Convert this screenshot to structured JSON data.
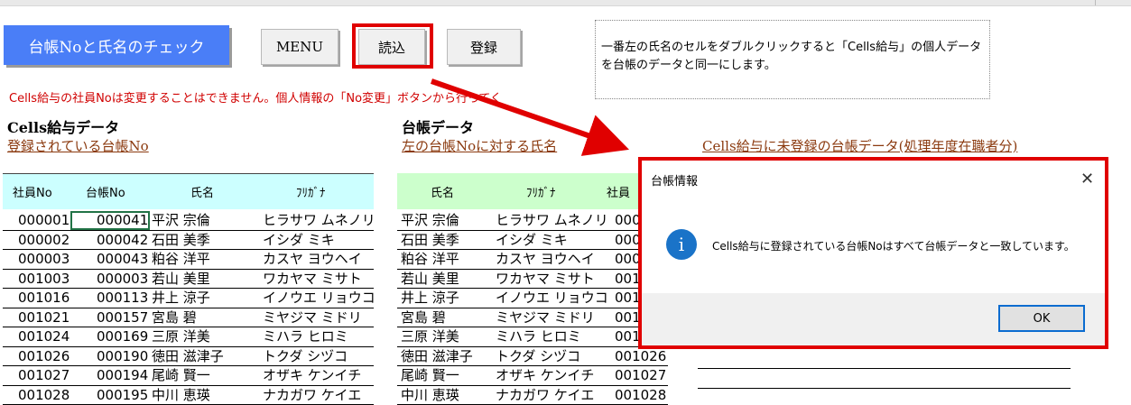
{
  "toolbar": {
    "title_button": "台帳Noと氏名のチェック",
    "menu_button": "MENU",
    "read_button": "読込",
    "register_button": "登録"
  },
  "note": "一番左の氏名のセルをダブルクリックすると「Cells給与」の個人データを台帳のデータと同一にします。",
  "warning": "Cells給与の社員Noは変更することはできません。個人情報の「No変更」ボタンから行ってく",
  "left_section": {
    "title": "Cells給与データ",
    "link": "登録されている台帳No",
    "headers": [
      "社員No",
      "台帳No",
      "氏名",
      "ﾌﾘｶﾞﾅ"
    ],
    "rows": [
      [
        "000001",
        "000041",
        "平沢 宗倫",
        "ヒラサワ ムネノリ"
      ],
      [
        "000002",
        "000042",
        "石田 美季",
        "イシダ ミキ"
      ],
      [
        "000003",
        "000043",
        "粕谷 洋平",
        "カスヤ ヨウヘイ"
      ],
      [
        "001003",
        "000003",
        "若山 美里",
        "ワカヤマ ミサト"
      ],
      [
        "001016",
        "000113",
        "井上 涼子",
        "イノウエ リョウコ"
      ],
      [
        "001021",
        "000157",
        "宮島 碧",
        "ミヤジマ ミドリ"
      ],
      [
        "001024",
        "000169",
        "三原 洋美",
        "ミハラ ヒロミ"
      ],
      [
        "001026",
        "000190",
        "徳田 滋津子",
        "トクダ シヅコ"
      ],
      [
        "001027",
        "000194",
        "尾崎 賢一",
        "オザキ ケンイチ"
      ],
      [
        "001028",
        "000195",
        "中川 恵瑛",
        "ナカガワ ケイエ"
      ]
    ]
  },
  "right_section": {
    "title": "台帳データ",
    "link": "左の台帳Noに対する氏名",
    "headers": [
      "氏名",
      "ﾌﾘｶﾞﾅ",
      "社員"
    ],
    "rows": [
      [
        "平沢 宗倫",
        "ヒラサワ ムネノリ",
        "000"
      ],
      [
        "石田 美季",
        "イシダ ミキ",
        "000"
      ],
      [
        "粕谷 洋平",
        "カスヤ ヨウヘイ",
        "000"
      ],
      [
        "若山 美里",
        "ワカヤマ ミサト",
        "001"
      ],
      [
        "井上 涼子",
        "イノウエ リョウコ",
        "001"
      ],
      [
        "宮島 碧",
        "ミヤジマ ミドリ",
        "001"
      ],
      [
        "三原 洋美",
        "ミハラ ヒロミ",
        "001"
      ],
      [
        "徳田 滋津子",
        "トクダ シヅコ",
        "001026"
      ],
      [
        "尾崎 賢一",
        "オザキ ケンイチ",
        "001027"
      ],
      [
        "中川 恵瑛",
        "ナカガワ ケイエ",
        "001028"
      ]
    ]
  },
  "unregistered_link": "Cells給与に未登録の台帳データ(処理年度在職者分)",
  "dialog": {
    "title": "台帳情報",
    "icon": "info-icon",
    "message": "Cells給与に登録されている台帳Noはすべて台帳データと一致しています。",
    "ok_button": "OK"
  },
  "colors": {
    "title_button_bg": "#4a7ef7",
    "highlight_red": "#e00000",
    "left_header_bg": "#ccffff",
    "right_header_bg": "#ccffcc",
    "link_brown": "#8b3a0f",
    "info_blue": "#1a73c8"
  }
}
